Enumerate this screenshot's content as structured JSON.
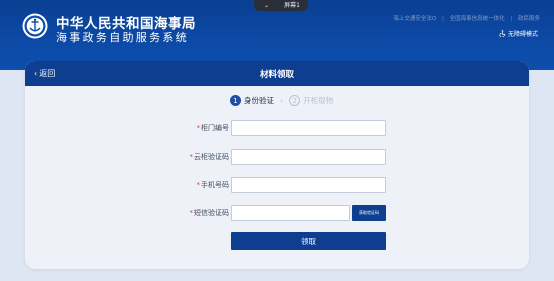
{
  "screen_tab": {
    "label": "屏幕1",
    "chevron": "chevron-down-icon"
  },
  "header": {
    "title": "中华人民共和国海事局",
    "subtitle": "海事政务自助服务系统",
    "links": [
      "海上交通安全法Q",
      "全国海事信息统一体化",
      "政民服务"
    ],
    "accessibility": "无障碍模式",
    "colors": {
      "bar": "#0c4aa6",
      "accent": "#0d3e8f"
    }
  },
  "card": {
    "back": "返回",
    "title": "材料领取"
  },
  "steps": [
    {
      "num": "1",
      "label": "身份验证",
      "state": "active"
    },
    {
      "num": "2",
      "label": "开柜取物",
      "state": "inactive"
    }
  ],
  "form": {
    "cabinet_no": {
      "label": "柜门编号",
      "value": ""
    },
    "cloud_code": {
      "label": "云柜验证码",
      "value": ""
    },
    "phone": {
      "label": "手机号码",
      "value": ""
    },
    "sms_code": {
      "label": "短信验证码",
      "value": "",
      "button": "获取验证码"
    },
    "submit": "领取"
  }
}
